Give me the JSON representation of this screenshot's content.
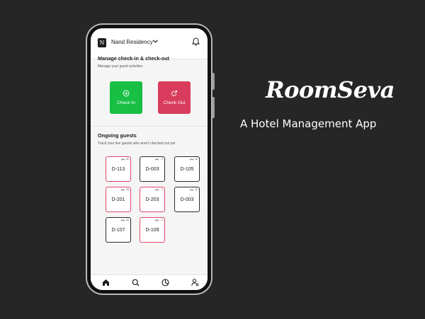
{
  "app": {
    "brand": "RoomSeva",
    "tagline": "A Hotel Management App"
  },
  "header": {
    "logo_letter": "N",
    "hotel_name": "Nand Residency",
    "chevron_icon": "chevron-down-icon",
    "notification_icon": "bell-icon"
  },
  "manage": {
    "title": "Manage check-in & check-out",
    "subtitle": "Manage your guest activities",
    "checkin_label": "Check In",
    "checkout_label": "Check Out",
    "checkin_color": "#18bf45",
    "checkout_color": "#d83b5c"
  },
  "guests": {
    "title": "Ongoing guests",
    "subtitle": "Track your live guests who aren't checked out yet",
    "rooms": [
      {
        "number": "D-113",
        "meta": "22",
        "status": "red"
      },
      {
        "number": "D-003",
        "meta": "2",
        "status": "dark"
      },
      {
        "number": "D-105",
        "meta": "12",
        "status": "dark"
      },
      {
        "number": "D-201",
        "meta": "24",
        "status": "red"
      },
      {
        "number": "D-203",
        "meta": "2",
        "status": "red"
      },
      {
        "number": "D-003",
        "meta": "12",
        "status": "dark"
      },
      {
        "number": "D-107",
        "meta": "22",
        "status": "dark"
      },
      {
        "number": "D-109",
        "meta": "2",
        "status": "red"
      }
    ]
  },
  "nav": {
    "items": [
      "home-icon",
      "search-icon",
      "clock-icon",
      "user-settings-icon"
    ]
  }
}
